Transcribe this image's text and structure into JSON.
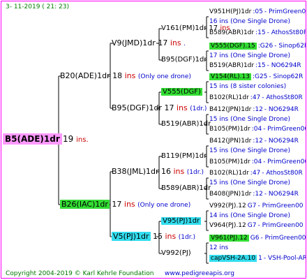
{
  "date": "3-  11-2019  ( 21:  23)",
  "root": {
    "name": "B5(ADE)1dr",
    "ins": "19",
    "ins_word": "ins."
  },
  "gen1": [
    {
      "id": "f",
      "name": "B20(ADE)1dr",
      "ins": "18",
      "ins_word": "ins",
      "note": "(Only one drone)"
    },
    {
      "id": "m",
      "name": "B26(IAC)1dr",
      "ins": "17",
      "ins_word": "ins",
      "note": "(Only one drone)"
    }
  ],
  "gen2": [
    {
      "id": "ff",
      "name": "V9(JMD)1dr",
      "ins": "17",
      "ins_word": "ins",
      "note": "."
    },
    {
      "id": "fm",
      "name": "B95(DGF)1dr",
      "ins": "17",
      "ins_word": "ins",
      "note": "(1dr.)"
    },
    {
      "id": "mf",
      "name": "B38(JML)1dr",
      "ins": "16",
      "ins_word": "ins",
      "note": "(1dr.)"
    },
    {
      "id": "mm",
      "name": "V5(PJ)1dr",
      "ins": "15",
      "ins_word": "ins",
      "note": "(1dr.)"
    }
  ],
  "gen3": [
    {
      "name": "V161(PM)1dr",
      "ins": "17",
      "ins_word": "ins",
      "note": "."
    },
    {
      "name": "B95(DGF)1dr",
      "ins": "",
      "ins_word": "",
      "note": ""
    },
    {
      "name": "V555(DGF)",
      "ins": "",
      "ins_word": "",
      "note": ""
    },
    {
      "name": "B519(ABR)1dr",
      "ins": "",
      "ins_word": "",
      "note": ""
    },
    {
      "name": "B119(PM)1dr",
      "ins": "",
      "ins_word": "",
      "note": ""
    },
    {
      "name": "B589(ABR)1dr",
      "ins": "",
      "ins_word": "",
      "note": ""
    },
    {
      "name": "V95(PJ)1dr",
      "ins": "14",
      "ins_word": "ins",
      "note": "."
    },
    {
      "name": "V992(PJ)",
      "ins": "",
      "ins_word": "",
      "note": ""
    }
  ],
  "gen4": [
    {
      "name": "V951H(PJ)1dr",
      "code": ":05",
      "origin": "- PrimGreen00"
    },
    {
      "text": "16 ins (One Single Drone)"
    },
    {
      "name": "B589(ABR)1dr",
      "code": ":15",
      "origin": "- AthosSt80R"
    },
    {
      "name": "V555(DGF).15",
      "code": ":G26",
      "origin": "- Sinop62R"
    },
    {
      "text": "17 ins (One Single Drone)"
    },
    {
      "name": "B519(ABR)1dr",
      "code": ":15",
      "origin": "- NO6294R"
    },
    {
      "name": "V154(RL).13",
      "code": ":G25",
      "origin": "- Sinop62R"
    },
    {
      "text": "15 ins (8 sister colonies)"
    },
    {
      "name": "B102(RL)1dr",
      "code": ":47",
      "origin": "- AthosSt80R"
    },
    {
      "name": "B412(JPN)1dr",
      "code": ":12",
      "origin": "- NO6294R"
    },
    {
      "text": "15 ins (One Single Drone)"
    },
    {
      "name": "B105(PM)1dr",
      "code": ":04",
      "origin": "- PrimGreen00"
    },
    {
      "name": "B412(JPN)1dr",
      "code": ":12",
      "origin": "- NO6294R"
    },
    {
      "text": "15 ins (One Single Drone)"
    },
    {
      "name": "B105(PM)1dr",
      "code": ":04",
      "origin": "- PrimGreen00"
    },
    {
      "name": "B102(RL)1dr",
      "code": ":47",
      "origin": "- AthosSt80R"
    },
    {
      "text": "15 ins (One Single Drone)"
    },
    {
      "name": "B408(JPN)1dr",
      "code": ":12",
      "origin": "- NO6294R"
    },
    {
      "name": "V992(PJ).12",
      "code": "G7",
      "origin": "- PrimGreen00"
    },
    {
      "text": "14 ins (One Single Drone)"
    },
    {
      "name": "V964(PJ).12",
      "code": "G7",
      "origin": "- PrimGreen00"
    },
    {
      "name": "V961(PJ).12",
      "code": "G6",
      "origin": "- PrimGreen00"
    },
    {
      "text": "12 ins"
    },
    {
      "name": "capVSH-2A.10",
      "code": "1",
      "origin": "- VSH-Pool-AR"
    }
  ],
  "footer": {
    "copyright": "Copyright 2004-2019 © Karl Kehrle Foundation",
    "url": "www.pedigreeapis.org"
  },
  "colors": {
    "border": "#ff00ff",
    "line": "#000000",
    "ins": "#cc0000",
    "subtitle": "#0000cc",
    "green_box": "#33dd33",
    "cyan_box": "#33ddee",
    "pink_box": "#ff99ff",
    "date": "#008000"
  }
}
